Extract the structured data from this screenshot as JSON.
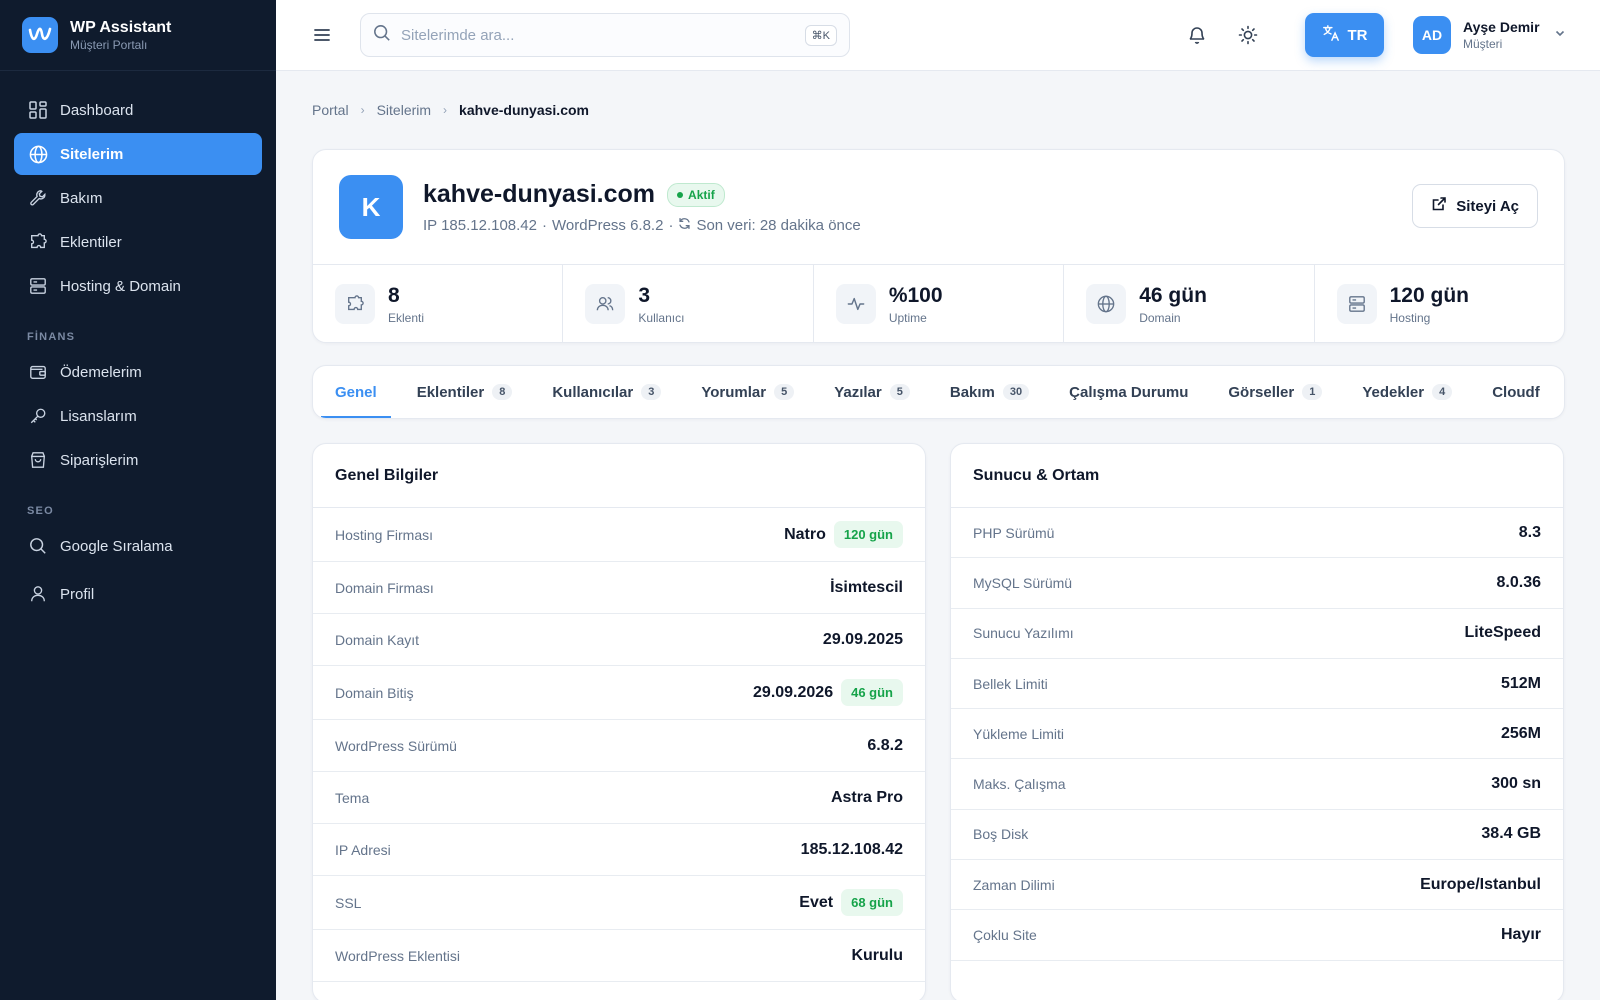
{
  "brand": {
    "title": "WP Assistant",
    "subtitle": "Müşteri Portalı"
  },
  "sidebar": {
    "items": [
      {
        "label": "Dashboard",
        "icon": "dashboard-icon"
      },
      {
        "label": "Sitelerim",
        "icon": "globe-icon",
        "active": true
      },
      {
        "label": "Bakım",
        "icon": "wrench-icon"
      },
      {
        "label": "Eklentiler",
        "icon": "puzzle-icon"
      },
      {
        "label": "Hosting & Domain",
        "icon": "server-icon"
      }
    ],
    "finance_section": "FİNANS",
    "finance_items": [
      {
        "label": "Ödemelerim",
        "icon": "wallet-icon"
      },
      {
        "label": "Lisanslarım",
        "icon": "key-icon"
      },
      {
        "label": "Siparişlerim",
        "icon": "shopping-bag-icon"
      }
    ],
    "seo_section": "SEO",
    "seo_items": [
      {
        "label": "Google Sıralama",
        "icon": "search-icon"
      },
      {
        "label": "Profil",
        "icon": "user-icon"
      }
    ]
  },
  "topbar": {
    "search_placeholder": "Sitelerimde ara...",
    "shortcut": "⌘K",
    "language": "TR",
    "user": {
      "initials": "AD",
      "name": "Ayşe Demir",
      "role": "Müşteri"
    }
  },
  "breadcrumb": [
    "Portal",
    "Sitelerim",
    "kahve-dunyasi.com"
  ],
  "site": {
    "initial": "K",
    "domain": "kahve-dunyasi.com",
    "status": "Aktif",
    "ip_text": "IP 185.12.108.42",
    "wp_text": "WordPress 6.8.2",
    "last_data": "Son veri: 28 dakika önce",
    "open_label": "Siteyi Aç"
  },
  "stats": [
    {
      "value": "8",
      "label": "Eklenti",
      "icon": "puzzle-icon"
    },
    {
      "value": "3",
      "label": "Kullanıcı",
      "icon": "users-icon"
    },
    {
      "value": "%100",
      "label": "Uptime",
      "icon": "activity-icon"
    },
    {
      "value": "46 gün",
      "label": "Domain",
      "icon": "globe-icon"
    },
    {
      "value": "120 gün",
      "label": "Hosting",
      "icon": "server-icon"
    }
  ],
  "tabs": [
    {
      "label": "Genel",
      "count": null,
      "active": true
    },
    {
      "label": "Eklentiler",
      "count": "8"
    },
    {
      "label": "Kullanıcılar",
      "count": "3"
    },
    {
      "label": "Yorumlar",
      "count": "5"
    },
    {
      "label": "Yazılar",
      "count": "5"
    },
    {
      "label": "Bakım",
      "count": "30"
    },
    {
      "label": "Çalışma Durumu",
      "count": null
    },
    {
      "label": "Görseller",
      "count": "1"
    },
    {
      "label": "Yedekler",
      "count": "4"
    },
    {
      "label": "Cloudf",
      "count": null
    }
  ],
  "general": {
    "title": "Genel Bilgiler",
    "rows": [
      {
        "label": "Hosting Firması",
        "value": "Natro",
        "pill": "120 gün"
      },
      {
        "label": "Domain Firması",
        "value": "İsimtescil"
      },
      {
        "label": "Domain Kayıt",
        "value": "29.09.2025"
      },
      {
        "label": "Domain Bitiş",
        "value": "29.09.2026",
        "pill": "46 gün"
      },
      {
        "label": "WordPress Sürümü",
        "value": "6.8.2"
      },
      {
        "label": "Tema",
        "value": "Astra Pro"
      },
      {
        "label": "IP Adresi",
        "value": "185.12.108.42"
      },
      {
        "label": "SSL",
        "value": "Evet",
        "pill": "68 gün"
      },
      {
        "label": "WordPress Eklentisi",
        "value": "Kurulu"
      }
    ]
  },
  "server": {
    "title": "Sunucu & Ortam",
    "rows": [
      {
        "label": "PHP Sürümü",
        "value": "8.3"
      },
      {
        "label": "MySQL Sürümü",
        "value": "8.0.36"
      },
      {
        "label": "Sunucu Yazılımı",
        "value": "LiteSpeed"
      },
      {
        "label": "Bellek Limiti",
        "value": "512M"
      },
      {
        "label": "Yükleme Limiti",
        "value": "256M"
      },
      {
        "label": "Maks. Çalışma",
        "value": "300 sn"
      },
      {
        "label": "Boş Disk",
        "value": "38.4 GB"
      },
      {
        "label": "Zaman Dilimi",
        "value": "Europe/Istanbul"
      },
      {
        "label": "Çoklu Site",
        "value": "Hayır"
      }
    ]
  },
  "colors": {
    "accent": "#3b8ff2",
    "sidebar_bg": "#0f1b2d",
    "success": "#16a34a"
  }
}
